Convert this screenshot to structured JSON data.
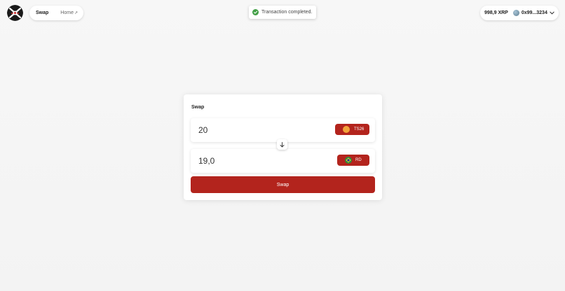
{
  "nav": {
    "swap_label": "Swap",
    "home_label": "Home",
    "home_ext_glyph": "↗"
  },
  "toast": {
    "message": "Transaction completed.",
    "icon": "check-circle-icon",
    "color": "#43a047"
  },
  "wallet": {
    "balance": "998,9 XRP",
    "account": "0x99...3234"
  },
  "swap_card": {
    "title": "Swap",
    "from": {
      "amount": "20",
      "token": "TS26",
      "token_icon": "orange-coin-icon"
    },
    "to": {
      "amount": "19,0",
      "token": "RD",
      "token_icon": "brazil-flag-icon"
    },
    "submit_label": "Swap"
  },
  "colors": {
    "accent": "#b3241d",
    "background": "#f5f5f5"
  }
}
